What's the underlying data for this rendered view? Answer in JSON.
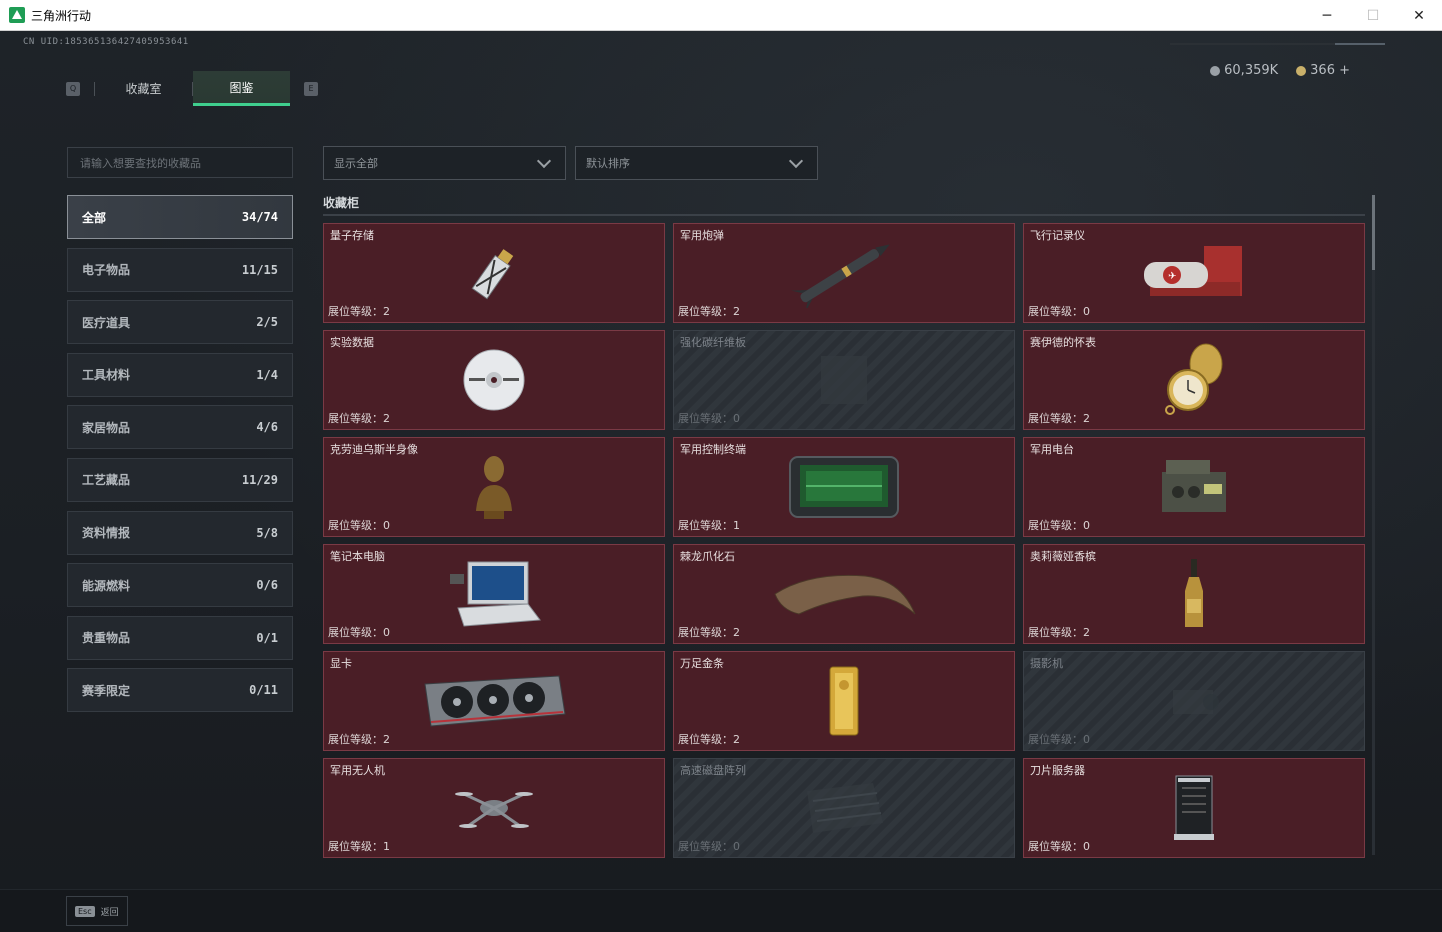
{
  "window": {
    "title": "三角洲行动",
    "minimize": "─",
    "maximize": "☐",
    "close": "✕"
  },
  "uid": "CN UID:185365136427405953641",
  "currency": [
    {
      "amount": "60,359K",
      "color": "#9aa0a6"
    },
    {
      "amount": "366 +",
      "color": "#c9b06a"
    }
  ],
  "tabs": {
    "left_key": "Q",
    "right_key": "E",
    "items": [
      {
        "label": "收藏室",
        "active": false
      },
      {
        "label": "图鉴",
        "active": true
      }
    ]
  },
  "search": {
    "placeholder": "请输入想要查找的收藏品"
  },
  "filters": {
    "show": "显示全部",
    "sort": "默认排序"
  },
  "categories": [
    {
      "name": "全部",
      "count": "34/74",
      "active": true
    },
    {
      "name": "电子物品",
      "count": "11/15"
    },
    {
      "name": "医疗道具",
      "count": "2/5"
    },
    {
      "name": "工具材料",
      "count": "1/4"
    },
    {
      "name": "家居物品",
      "count": "4/6"
    },
    {
      "name": "工艺藏品",
      "count": "11/29"
    },
    {
      "name": "资料情报",
      "count": "5/8"
    },
    {
      "name": "能源燃料",
      "count": "0/6"
    },
    {
      "name": "贵重物品",
      "count": "0/1"
    },
    {
      "name": "赛季限定",
      "count": "0/11"
    }
  ],
  "section_title": "收藏柜",
  "items": [
    {
      "name": "量子存储",
      "level": "展位等级：2",
      "locked": false,
      "icon": "usb-drive-icon"
    },
    {
      "name": "军用炮弹",
      "level": "展位等级：2",
      "locked": false,
      "icon": "missile-icon"
    },
    {
      "name": "飞行记录仪",
      "level": "展位等级：0",
      "locked": false,
      "icon": "flight-recorder-icon"
    },
    {
      "name": "实验数据",
      "level": "展位等级：2",
      "locked": false,
      "icon": "disc-icon"
    },
    {
      "name": "强化碳纤维板",
      "level": "展位等级：0",
      "locked": true,
      "icon": "carbon-plate-icon"
    },
    {
      "name": "赛伊德的怀表",
      "level": "展位等级：2",
      "locked": false,
      "icon": "pocket-watch-icon"
    },
    {
      "name": "克劳迪乌斯半身像",
      "level": "展位等级：0",
      "locked": false,
      "icon": "bust-icon"
    },
    {
      "name": "军用控制终端",
      "level": "展位等级：1",
      "locked": false,
      "icon": "terminal-icon"
    },
    {
      "name": "军用电台",
      "level": "展位等级：0",
      "locked": false,
      "icon": "radio-icon"
    },
    {
      "name": "笔记本电脑",
      "level": "展位等级：0",
      "locked": false,
      "icon": "laptop-icon"
    },
    {
      "name": "棘龙爪化石",
      "level": "展位等级：2",
      "locked": false,
      "icon": "claw-fossil-icon"
    },
    {
      "name": "奥莉薇娅香槟",
      "level": "展位等级：2",
      "locked": false,
      "icon": "champagne-icon"
    },
    {
      "name": "显卡",
      "level": "展位等级：2",
      "locked": false,
      "icon": "gpu-icon"
    },
    {
      "name": "万足金条",
      "level": "展位等级：2",
      "locked": false,
      "icon": "gold-bar-icon"
    },
    {
      "name": "摄影机",
      "level": "展位等级：0",
      "locked": true,
      "icon": "camera-icon"
    },
    {
      "name": "军用无人机",
      "level": "展位等级：1",
      "locked": false,
      "icon": "drone-icon"
    },
    {
      "name": "高速磁盘阵列",
      "level": "展位等级：0",
      "locked": true,
      "icon": "disk-array-icon"
    },
    {
      "name": "刀片服务器",
      "level": "展位等级：0",
      "locked": false,
      "icon": "server-icon"
    }
  ],
  "bottom": {
    "esc_key": "Esc",
    "esc_label": "返回"
  }
}
